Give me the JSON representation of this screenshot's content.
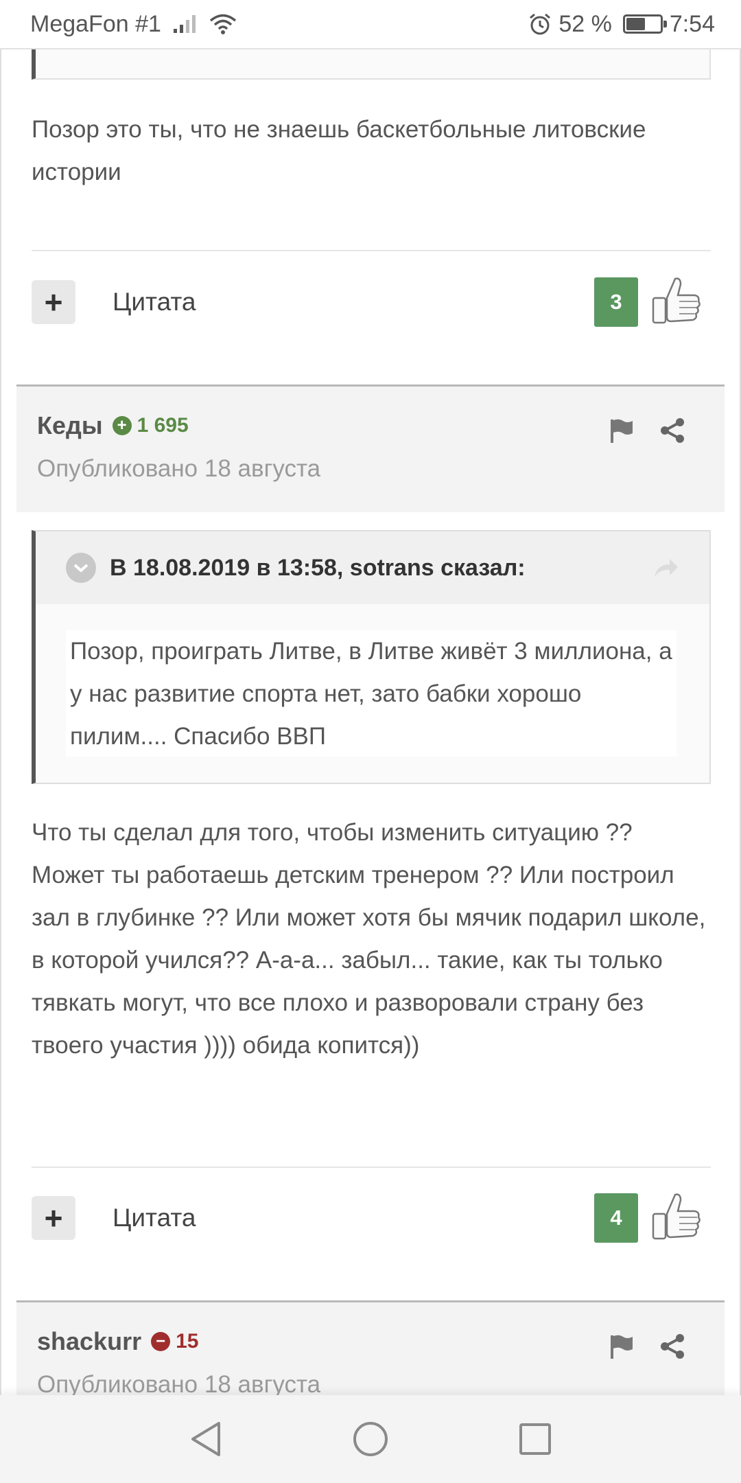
{
  "status_bar": {
    "carrier": "MegaFon #1",
    "battery_percent": "52 %",
    "time": "7:54"
  },
  "posts": [
    {
      "text": "Позор это ты, что не знаешь баскетбольные литовские истории",
      "quote_label": "Цитата",
      "reputation": "3"
    },
    {
      "author": "Кеды",
      "author_rep": "1 695",
      "published": "Опубликовано 18 августа",
      "quote_header": "В 18.08.2019 в 13:58, sotrans сказал:",
      "quote_text": "Позор, проиграть Литве, в Литве живёт 3 миллиона, а у нас развитие спорта нет, зато бабки хорошо пилим.... Спасибо ВВП",
      "text": "Что ты сделал для того, чтобы изменить ситуацию ?? Может ты работаешь детским тренером ?? Или построил зал в глубинке ?? Или может хотя бы мячик подарил школе, в которой учился?? А-а-а... забыл... такие, как ты только тявкать могут, что все плохо и разворовали страну без твоего участия )))) обида копится))",
      "quote_label": "Цитата",
      "reputation": "4"
    },
    {
      "author": "shackurr",
      "author_rep": "15",
      "published": "Опубликовано 18 августа"
    }
  ],
  "colors": {
    "rep_positive": "#5a8a46",
    "rep_negative": "#a02d2d",
    "like_count_bg": "#5a9860"
  }
}
